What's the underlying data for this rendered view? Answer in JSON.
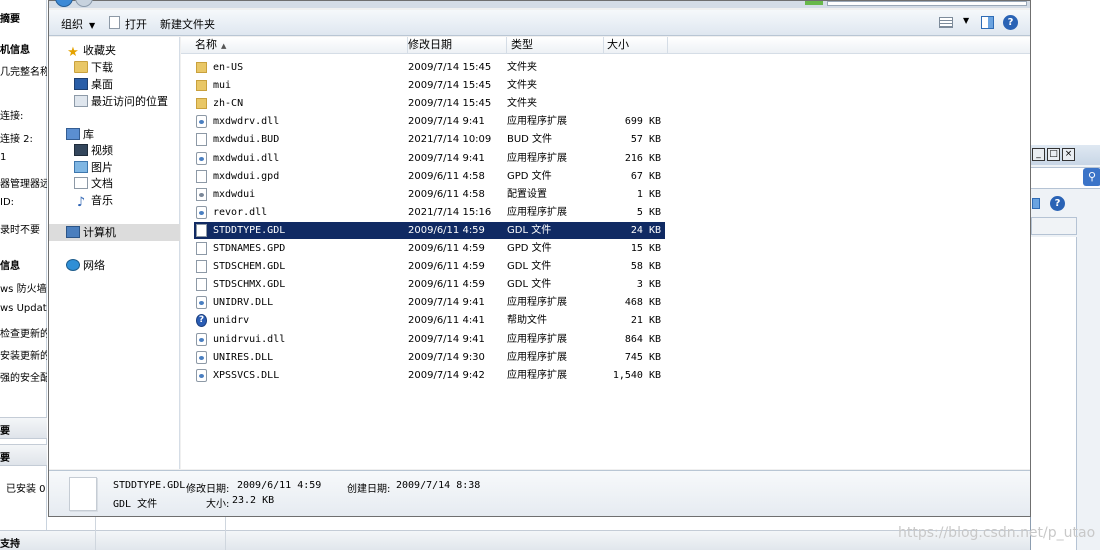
{
  "background_window": {
    "left_items": [
      {
        "text": "摘要",
        "bold": true
      },
      {
        "text": "机信息",
        "bold": true
      },
      {
        "text": "几完整名称",
        "bold": false
      },
      {
        "text": "连接:",
        "bold": false
      },
      {
        "text": "连接 2:",
        "bold": false
      },
      {
        "text": "1",
        "bold": false
      },
      {
        "text": "器管理器远",
        "bold": false
      },
      {
        "text": "ID:",
        "bold": false
      },
      {
        "text": "录时不要",
        "bold": false
      },
      {
        "text": "信息",
        "bold": true
      },
      {
        "text": "ws 防火墙",
        "bold": false
      },
      {
        "text": "ws Update",
        "bold": false
      },
      {
        "text": "检查更新的",
        "bold": false
      },
      {
        "text": "安装更新的",
        "bold": false
      },
      {
        "text": "强的安全配",
        "bold": false
      }
    ],
    "band_1": "要",
    "band_2": "要",
    "installed_label": "已安装 0",
    "bottom_band": "支持"
  },
  "toolbar": {
    "organize": "组织",
    "open": "打开",
    "new_folder": "新建文件夹",
    "help": "?"
  },
  "nav": {
    "favorites": "收藏夹",
    "downloads": "下载",
    "desktop": "桌面",
    "recent": "最近访问的位置",
    "libraries": "库",
    "videos": "视频",
    "pictures": "图片",
    "documents": "文档",
    "music": "音乐",
    "computer": "计算机",
    "network": "网络"
  },
  "columns": {
    "name": "名称",
    "date": "修改日期",
    "type": "类型",
    "size": "大小"
  },
  "files": [
    {
      "name": "en-US",
      "date": "2009/7/14 15:45",
      "type": "文件夹",
      "size": "",
      "icon": "folder"
    },
    {
      "name": "mui",
      "date": "2009/7/14 15:45",
      "type": "文件夹",
      "size": "",
      "icon": "folder"
    },
    {
      "name": "zh-CN",
      "date": "2009/7/14 15:45",
      "type": "文件夹",
      "size": "",
      "icon": "folder"
    },
    {
      "name": "mxdwdrv.dll",
      "date": "2009/7/14 9:41",
      "type": "应用程序扩展",
      "size": "699 KB",
      "icon": "dll"
    },
    {
      "name": "mxdwdui.BUD",
      "date": "2021/7/14 10:09",
      "type": "BUD 文件",
      "size": "57 KB",
      "icon": "doc"
    },
    {
      "name": "mxdwdui.dll",
      "date": "2009/7/14 9:41",
      "type": "应用程序扩展",
      "size": "216 KB",
      "icon": "dll"
    },
    {
      "name": "mxdwdui.gpd",
      "date": "2009/6/11 4:58",
      "type": "GPD 文件",
      "size": "67 KB",
      "icon": "doc"
    },
    {
      "name": "mxdwdui",
      "date": "2009/6/11 4:58",
      "type": "配置设置",
      "size": "1 KB",
      "icon": "cfg"
    },
    {
      "name": "revor.dll",
      "date": "2021/7/14 15:16",
      "type": "应用程序扩展",
      "size": "5 KB",
      "icon": "dll"
    },
    {
      "name": "STDDTYPE.GDL",
      "date": "2009/6/11 4:59",
      "type": "GDL 文件",
      "size": "24 KB",
      "icon": "doc",
      "selected": true
    },
    {
      "name": "STDNAMES.GPD",
      "date": "2009/6/11 4:59",
      "type": "GPD 文件",
      "size": "15 KB",
      "icon": "doc"
    },
    {
      "name": "STDSCHEM.GDL",
      "date": "2009/6/11 4:59",
      "type": "GDL 文件",
      "size": "58 KB",
      "icon": "doc"
    },
    {
      "name": "STDSCHMX.GDL",
      "date": "2009/6/11 4:59",
      "type": "GDL 文件",
      "size": "3 KB",
      "icon": "doc"
    },
    {
      "name": "UNIDRV.DLL",
      "date": "2009/7/14 9:41",
      "type": "应用程序扩展",
      "size": "468 KB",
      "icon": "dll"
    },
    {
      "name": "unidrv",
      "date": "2009/6/11 4:41",
      "type": "帮助文件",
      "size": "21 KB",
      "icon": "help"
    },
    {
      "name": "unidrvui.dll",
      "date": "2009/7/14 9:41",
      "type": "应用程序扩展",
      "size": "864 KB",
      "icon": "dll"
    },
    {
      "name": "UNIRES.DLL",
      "date": "2009/7/14 9:30",
      "type": "应用程序扩展",
      "size": "745 KB",
      "icon": "dll"
    },
    {
      "name": "XPSSVCS.DLL",
      "date": "2009/7/14 9:42",
      "type": "应用程序扩展",
      "size": "1,540 KB",
      "icon": "dll"
    }
  ],
  "details": {
    "name": "STDDTYPE.GDL",
    "modified_label": "修改日期:",
    "modified_value": "2009/6/11 4:59",
    "created_label": "创建日期:",
    "created_value": "2009/7/14 8:38",
    "type": "GDL 文件",
    "size_label": "大小:",
    "size_value": "23.2 KB"
  },
  "watermark": "https://blog.csdn.net/p_utao",
  "colors": {
    "selection": "#102a63",
    "accent": "#2a63b5"
  }
}
